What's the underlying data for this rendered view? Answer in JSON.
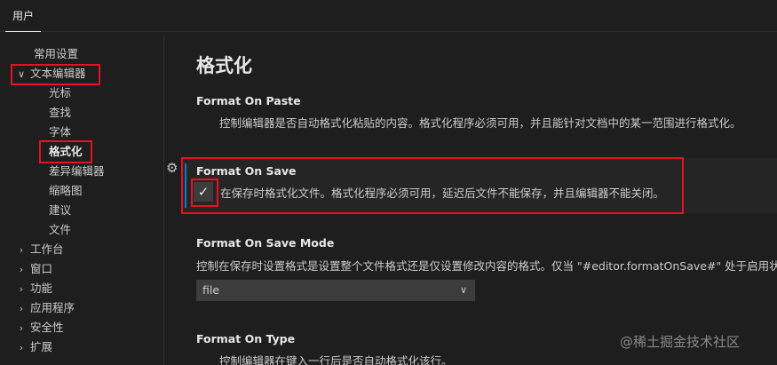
{
  "tabs": {
    "active": "用户"
  },
  "sidebar": {
    "items": [
      {
        "label": "常用设置",
        "indent": 0,
        "chevron": ""
      },
      {
        "label": "文本编辑器",
        "indent": 0,
        "chevron": "expanded"
      },
      {
        "label": "光标",
        "indent": 1,
        "chevron": ""
      },
      {
        "label": "查找",
        "indent": 1,
        "chevron": ""
      },
      {
        "label": "字体",
        "indent": 1,
        "chevron": ""
      },
      {
        "label": "格式化",
        "indent": 1,
        "chevron": "",
        "selected": true
      },
      {
        "label": "差异编辑器",
        "indent": 1,
        "chevron": ""
      },
      {
        "label": "缩略图",
        "indent": 1,
        "chevron": ""
      },
      {
        "label": "建议",
        "indent": 1,
        "chevron": ""
      },
      {
        "label": "文件",
        "indent": 1,
        "chevron": ""
      },
      {
        "label": "工作台",
        "indent": 0,
        "chevron": "collapsed"
      },
      {
        "label": "窗口",
        "indent": 0,
        "chevron": "collapsed"
      },
      {
        "label": "功能",
        "indent": 0,
        "chevron": "collapsed"
      },
      {
        "label": "应用程序",
        "indent": 0,
        "chevron": "collapsed"
      },
      {
        "label": "安全性",
        "indent": 0,
        "chevron": "collapsed"
      },
      {
        "label": "扩展",
        "indent": 0,
        "chevron": "collapsed"
      }
    ]
  },
  "main": {
    "section_title": "格式化",
    "settings": [
      {
        "title": "Format On Paste",
        "description": "控制编辑器是否自动格式化粘贴的内容。格式化程序必须可用，并且能针对文档中的某一范围进行格式化。"
      },
      {
        "title": "Format On Save",
        "checked": true,
        "description": "在保存时格式化文件。格式化程序必须可用，延迟后文件不能保存，并且编辑器不能关闭。"
      },
      {
        "title": "Format On Save Mode",
        "description": "控制在保存时设置格式是设置整个文件格式还是仅设置修改内容的格式。仅当 \"#editor.formatOnSave#\" 处于启用状",
        "value": "file"
      },
      {
        "title": "Format On Type",
        "description": "控制编辑器在键入一行后是否自动格式化该行。"
      }
    ]
  },
  "icons": {
    "gear": "gear-icon",
    "check": "check-icon",
    "chevron_down": "chevron-down-icon",
    "chevron_right": "chevron-right-icon"
  },
  "watermark": "@稀土掘金技术社区",
  "colors": {
    "highlight_box": "#e81123",
    "focus_bar": "#007fd4"
  }
}
